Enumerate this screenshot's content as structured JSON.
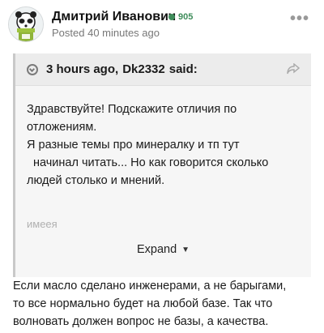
{
  "post": {
    "author": "Дмитрий Иванович",
    "reputation": "905",
    "posted": "Posted 40 minutes ago",
    "more_glyph": "•••"
  },
  "quote": {
    "time": "3 hours ago,",
    "user": "Dk2332",
    "said": "said:",
    "lines": [
      "Здравствуйте! Подскажите отличия по",
      "отложениям.",
      "Я разные темы про минералку и тп тут",
      "начинал читать... Но как говорится сколько",
      "людей столько и мнений."
    ],
    "faded_text": "имеея",
    "expand_label": "Expand"
  },
  "reply": {
    "lines": [
      "Если масло сделано инженерами, а не барыгами,",
      "то все нормально будет на любой базе. Так что",
      "волновать должен вопрос не базы, а качества."
    ]
  },
  "icons": {
    "avatar": "avatar-image",
    "reputation": "reputation-dot-icon",
    "quote": "quote-arrow-icon",
    "share": "share-arrow-icon",
    "expand": "caret-down-icon",
    "more": "more-options-icon"
  },
  "colors": {
    "reputation": "#3f8d5b",
    "quote_bg": "#f6f6f6",
    "quote_header_bg": "#ececec",
    "muted_text": "#777777"
  }
}
